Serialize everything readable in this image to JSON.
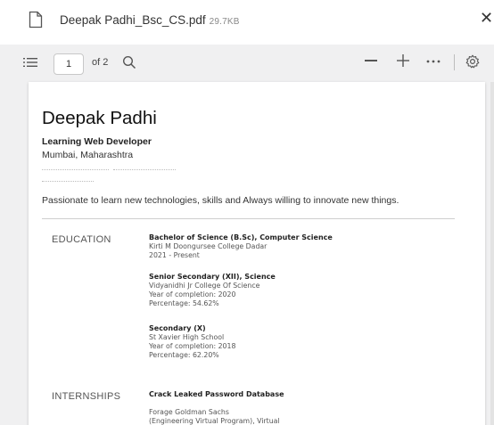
{
  "file": {
    "name": "Deepak Padhi_Bsc_CS.pdf",
    "size": "29.7KB",
    "icon": "document-icon",
    "close_icon": "close-icon"
  },
  "toolbar": {
    "current_page": "1",
    "of_pages": "of 2",
    "icons": [
      "outline-icon",
      "search-icon",
      "zoom-out-icon",
      "zoom-in-icon",
      "more-icon",
      "settings-icon"
    ]
  },
  "resume": {
    "name": "Deepak Padhi",
    "role": "Learning Web Developer",
    "location": "Mumbai, Maharashtra",
    "summary": "Passionate to learn new technologies, skills and Always willing to innovate new things.",
    "education_label": "EDUCATION",
    "education": [
      {
        "title": "Bachelor of Science (B.Sc), Computer Science",
        "lines": [
          "Kirti M Doongursee College Dadar",
          "2021 - Present"
        ]
      },
      {
        "title": "Senior Secondary (XII), Science",
        "lines": [
          "Vidyanidhi Jr College Of Science",
          "Year of completion: 2020",
          "Percentage: 54.62%"
        ]
      },
      {
        "title": "Secondary (X)",
        "lines": [
          "St Xavier High School",
          "Year of completion: 2018",
          "Percentage: 62.20%"
        ]
      }
    ],
    "internships_label": "INTERNSHIPS",
    "internship": {
      "title": "Crack Leaked Password Database",
      "lines": [
        "Forage Goldman Sachs",
        "(Engineering Virtual Program), Virtual"
      ]
    }
  }
}
